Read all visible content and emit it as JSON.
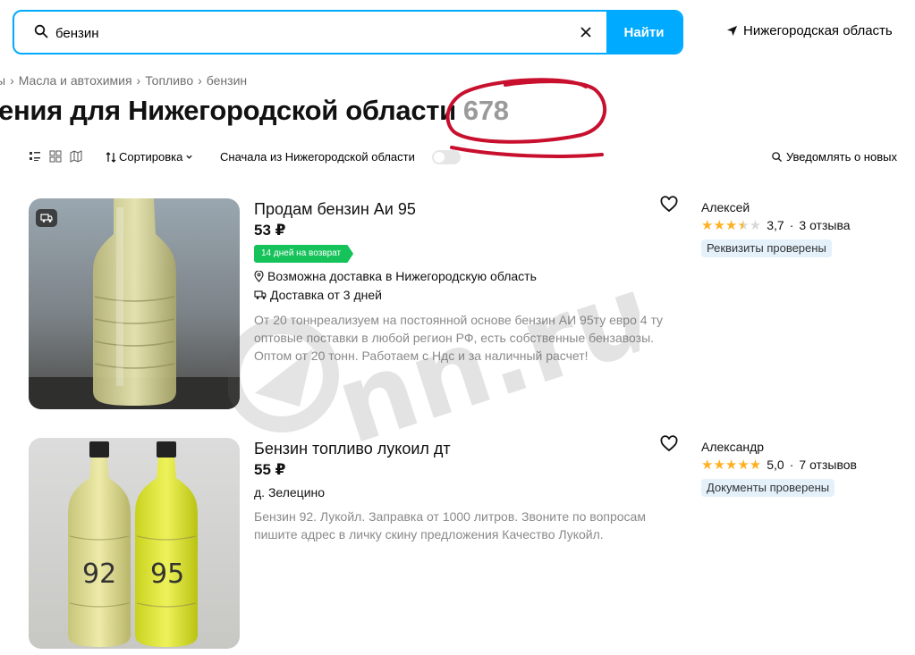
{
  "search": {
    "value": "бензин",
    "find_label": "Найти"
  },
  "region": {
    "label": "Нижегородская область"
  },
  "breadcrumb": [
    "ы",
    "Масла и автохимия",
    "Топливо",
    "бензин"
  ],
  "title": {
    "text": "ения для Нижегородской области",
    "count": "678"
  },
  "toolbar": {
    "sort_label": "Сортировка",
    "region_first_label": "Сначала из Нижегородской области",
    "notify_label": "Уведомлять о новых"
  },
  "listings": [
    {
      "title": "Продам бензин Аи 95",
      "price": "53 ₽",
      "return_badge": "14 дней на возврат",
      "delivery_region": "Возможна доставка в Нижегородскую область",
      "delivery_time": "Доставка от 3 дней",
      "description": "От 20 тоннреализуем на постоянной основе бензин АИ 95ту евро 4 ту оптовые поставки в любой регион РФ, есть собственные бензавозы. Оптом от 20 тонн. Работаем с Ндс и за наличный расчет!",
      "seller": {
        "name": "Алексей",
        "rating": "3,7",
        "stars": 3.5,
        "reviews": "3 отзыва",
        "verified": "Реквизиты проверены"
      }
    },
    {
      "title": "Бензин топливо лукоил дт",
      "price": "55 ₽",
      "location": "д. Зелецино",
      "description": "Бензин 92. Лукойл. Заправка от 1000 литров. Звоните по вопросам пишите адрес в личку скину предложения Качество Лукойл.",
      "bottle_labels": [
        "92",
        "95"
      ],
      "seller": {
        "name": "Александр",
        "rating": "5,0",
        "stars": 5,
        "reviews": "7 отзывов",
        "verified": "Документы проверены"
      }
    }
  ],
  "watermark": {
    "text": "nn.ru"
  },
  "colors": {
    "accent": "#00aaff",
    "badge_green": "#16c25a",
    "star": "#ffb021",
    "verified_bg": "#e4f1fb",
    "marker_red": "#c8102e"
  }
}
